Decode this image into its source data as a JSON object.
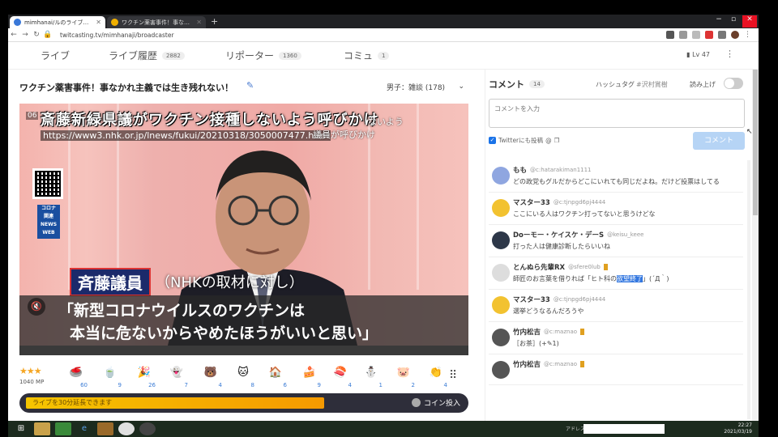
{
  "browser": {
    "tabs": [
      {
        "title": "mimhanai/ルのライブ配信",
        "active": true
      },
      {
        "title": "ワクチン薬害事件！事なかれ主...",
        "active": false
      }
    ],
    "new_tab": "+",
    "url": "twitcasting.tv/mimhanaji/broadcaster",
    "win_min": "−",
    "win_max": "▫",
    "win_close": "✕"
  },
  "nav": {
    "items": [
      {
        "label": "ライブ",
        "count": ""
      },
      {
        "label": "ライブ履歴",
        "count": "2882"
      },
      {
        "label": "リポーター",
        "count": "1360"
      },
      {
        "label": "コミュ",
        "count": "1"
      }
    ],
    "level": "Lv 47",
    "more": "⋮"
  },
  "video": {
    "title": "ワクチン薬害事件！事なかれ主義では生き残れない！",
    "category": "男子：雑談 (178)",
    "caption_title": "斎藤新緑県議がワクチン接種しないよう呼びかけ",
    "caption_title_tail": "ないよう",
    "caption_url": "https://www3.nhk.or.jp/lnews/fukui/20210318/3050007477.html",
    "caption_url_tail": "議員が呼びかけ",
    "timestamp": "06",
    "badge_lines": [
      "コロナ",
      "関連",
      "NEWS",
      "WEB"
    ],
    "speaker_name": "斉藤議員",
    "speaker_note": "（NHKの取材に対し）",
    "quote_line1": "「新型コロナウイルスのワクチンは",
    "quote_line2": "本当に危ないからやめたほうがいいと思い」"
  },
  "gifts": {
    "stars": "★★★",
    "mp": "1040 MP",
    "items": [
      {
        "name": "stone",
        "count": "60",
        "glyph": "🥌"
      },
      {
        "name": "tea",
        "count": "9",
        "glyph": "🍵"
      },
      {
        "name": "cracker",
        "count": "26",
        "glyph": "🎉"
      },
      {
        "name": "ghost",
        "count": "7",
        "glyph": "👻"
      },
      {
        "name": "bear",
        "count": "4",
        "glyph": "🐻"
      },
      {
        "name": "cat",
        "count": "8",
        "glyph": "🐱"
      },
      {
        "name": "house",
        "count": "6",
        "glyph": "🏠"
      },
      {
        "name": "cake",
        "count": "9",
        "glyph": "🍰"
      },
      {
        "name": "sushi",
        "count": "4",
        "glyph": "🍣"
      },
      {
        "name": "snowman",
        "count": "1",
        "glyph": "⛄"
      },
      {
        "name": "pig",
        "count": "2",
        "glyph": "🐷"
      },
      {
        "name": "clap",
        "count": "4",
        "glyph": "👏"
      }
    ],
    "grid": "⠿"
  },
  "progress": {
    "text": "ライブを30分延長できます",
    "fill_fraction": 0.8,
    "coin_label": "コイン投入"
  },
  "comments_panel": {
    "title": "コメント",
    "count": "14",
    "hashtag_label": "ハッシュタグ",
    "hashtag_value": "#沢村賞樹",
    "read_aloud": "読み上げ",
    "input_placeholder": "コメントを入力",
    "twitter_label": "Twitterにも投稿",
    "submit_label": "コメント",
    "comments": [
      {
        "name": "もも",
        "handle": "@c:hatarakiman1111",
        "text": "どの政党もグルだからどこにいれても同じだよね。だけど投票はしてる",
        "avatar_color": "#8fa6e0",
        "badge": false
      },
      {
        "name": "マスター33",
        "handle": "@c:tjnpgd6pj4444",
        "text": "ここにいる人はワクチン打ってないと思うけどな",
        "avatar_color": "#f2c230",
        "badge": false
      },
      {
        "name": "Doーモー・ケイスケ・デーS",
        "handle": "@keisu_keee",
        "text": "打った人は健康診断したらいいね",
        "avatar_color": "#2d3748",
        "badge": false
      },
      {
        "name": "とんぬら先輩RX",
        "handle": "@sfere0lub",
        "text_pre": "師匠のお言葉を借りれば「ヒト科の",
        "text_hl": "欲望終了",
        "text_post": "」(´Д｀)",
        "avatar_color": "#ddd",
        "badge": true
      },
      {
        "name": "マスター33",
        "handle": "@c:tjnpgd6pj4444",
        "text": "選挙どうなるんだろうや",
        "avatar_color": "#f2c230",
        "badge": false
      },
      {
        "name": "竹内松吉",
        "handle": "@c:maznao",
        "text": "［お茶］(+✎1)",
        "avatar_color": "#555",
        "badge": true
      },
      {
        "name": "竹内松吉",
        "handle": "@c:maznao",
        "text": "",
        "avatar_color": "#555",
        "badge": true
      }
    ]
  },
  "taskbar": {
    "address_label": "アドレス",
    "time": "22:27",
    "date": "2021/03/19"
  }
}
